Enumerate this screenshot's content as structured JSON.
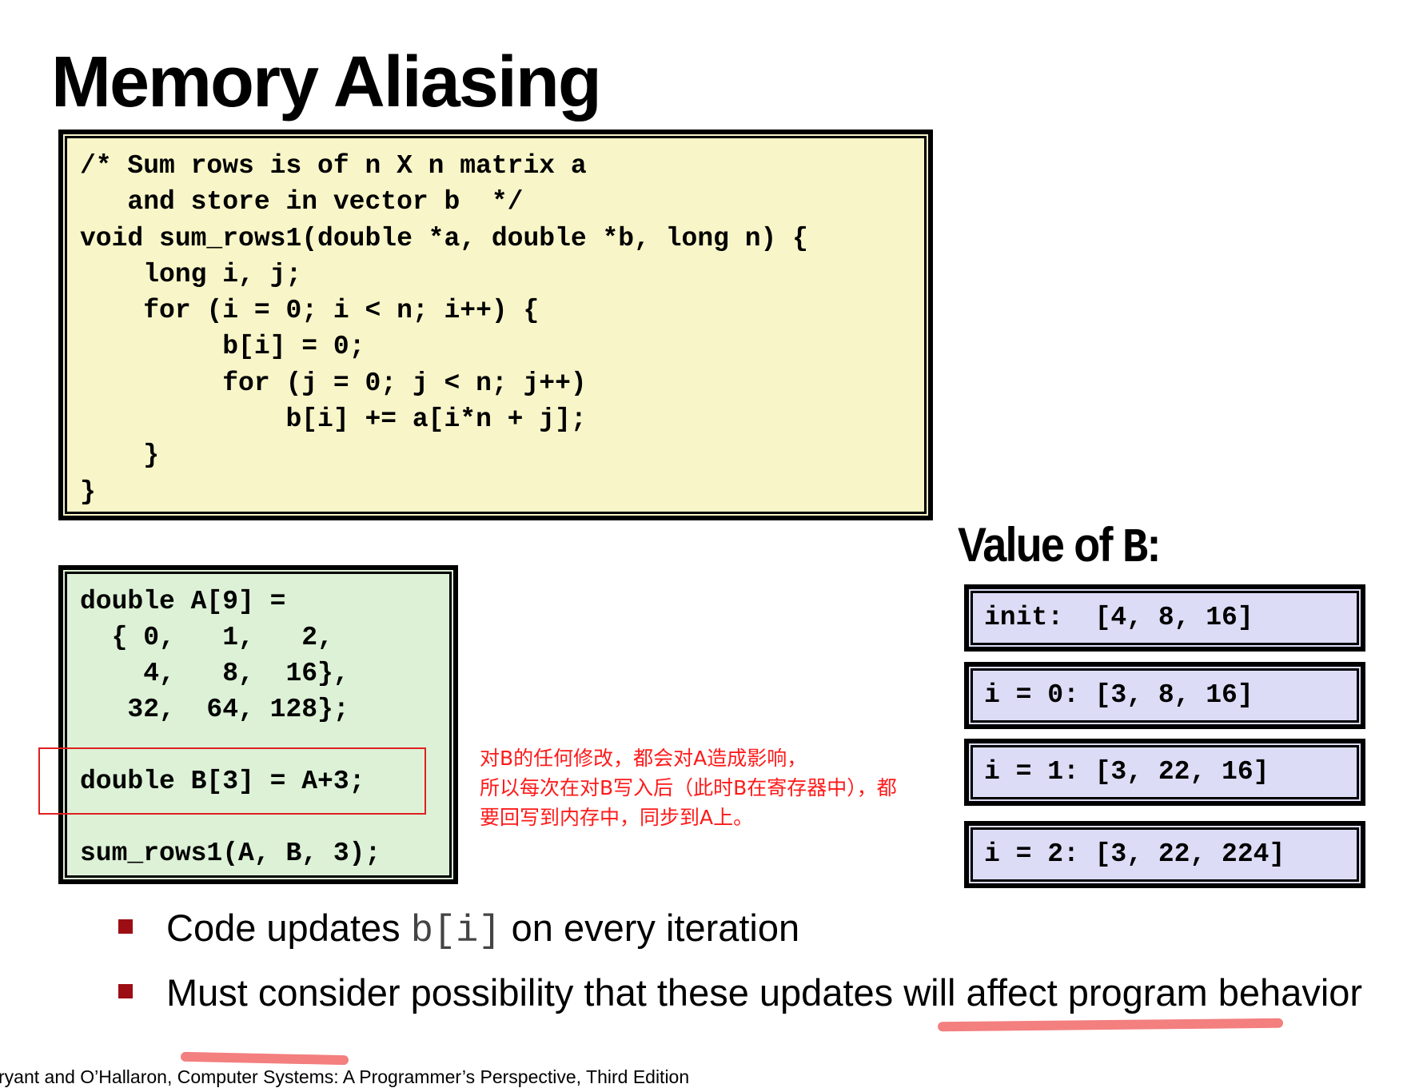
{
  "title": "Memory Aliasing",
  "sum_rows_code": "/* Sum rows is of n X n matrix a\n   and store in vector b  */\nvoid sum_rows1(double *a, double *b, long n) {\n    long i, j;\n    for (i = 0; i < n; i++) {\n         b[i] = 0;\n         for (j = 0; j < n; j++)\n             b[i] += a[i*n + j];\n    }\n}",
  "declaration_code": "double A[9] =\n  { 0,   1,   2,\n    4,   8,  16},\n   32,  64, 128};\n\ndouble B[3] = A+3;\n\nsum_rows1(A, B, 3);",
  "annotation_note": "对B的任何修改，都会对A造成影响，\n所以每次在对B写入后（此时B在寄存器中），都\n要回写到内存中，同步到A上。",
  "value_of_b": {
    "label_prefix": "Value of ",
    "label_var": "B",
    "label_suffix": ":",
    "rows": [
      "init:  [4, 8, 16]",
      "i = 0: [3, 8, 16]",
      "i = 1: [3, 22, 16]",
      "i = 2: [3, 22, 224]"
    ]
  },
  "bullets": {
    "b1_pre": "Code updates ",
    "b1_code": "b[i]",
    "b1_post": " on every iteration",
    "b2_text": "Must consider possibility that these updates will affect program behavior"
  },
  "footer": "ryant and O’Hallaron, Computer Systems: A Programmer’s Perspective, Third Edition",
  "colors": {
    "code_bg_yellow": "#f8f6c8",
    "code_bg_green": "#dcf1d6",
    "code_bg_blue": "#dcdcf6",
    "bullet_square": "#9c0e14",
    "annotation_red": "#ff1a1a",
    "underline_highlight": "#f37f7f"
  }
}
